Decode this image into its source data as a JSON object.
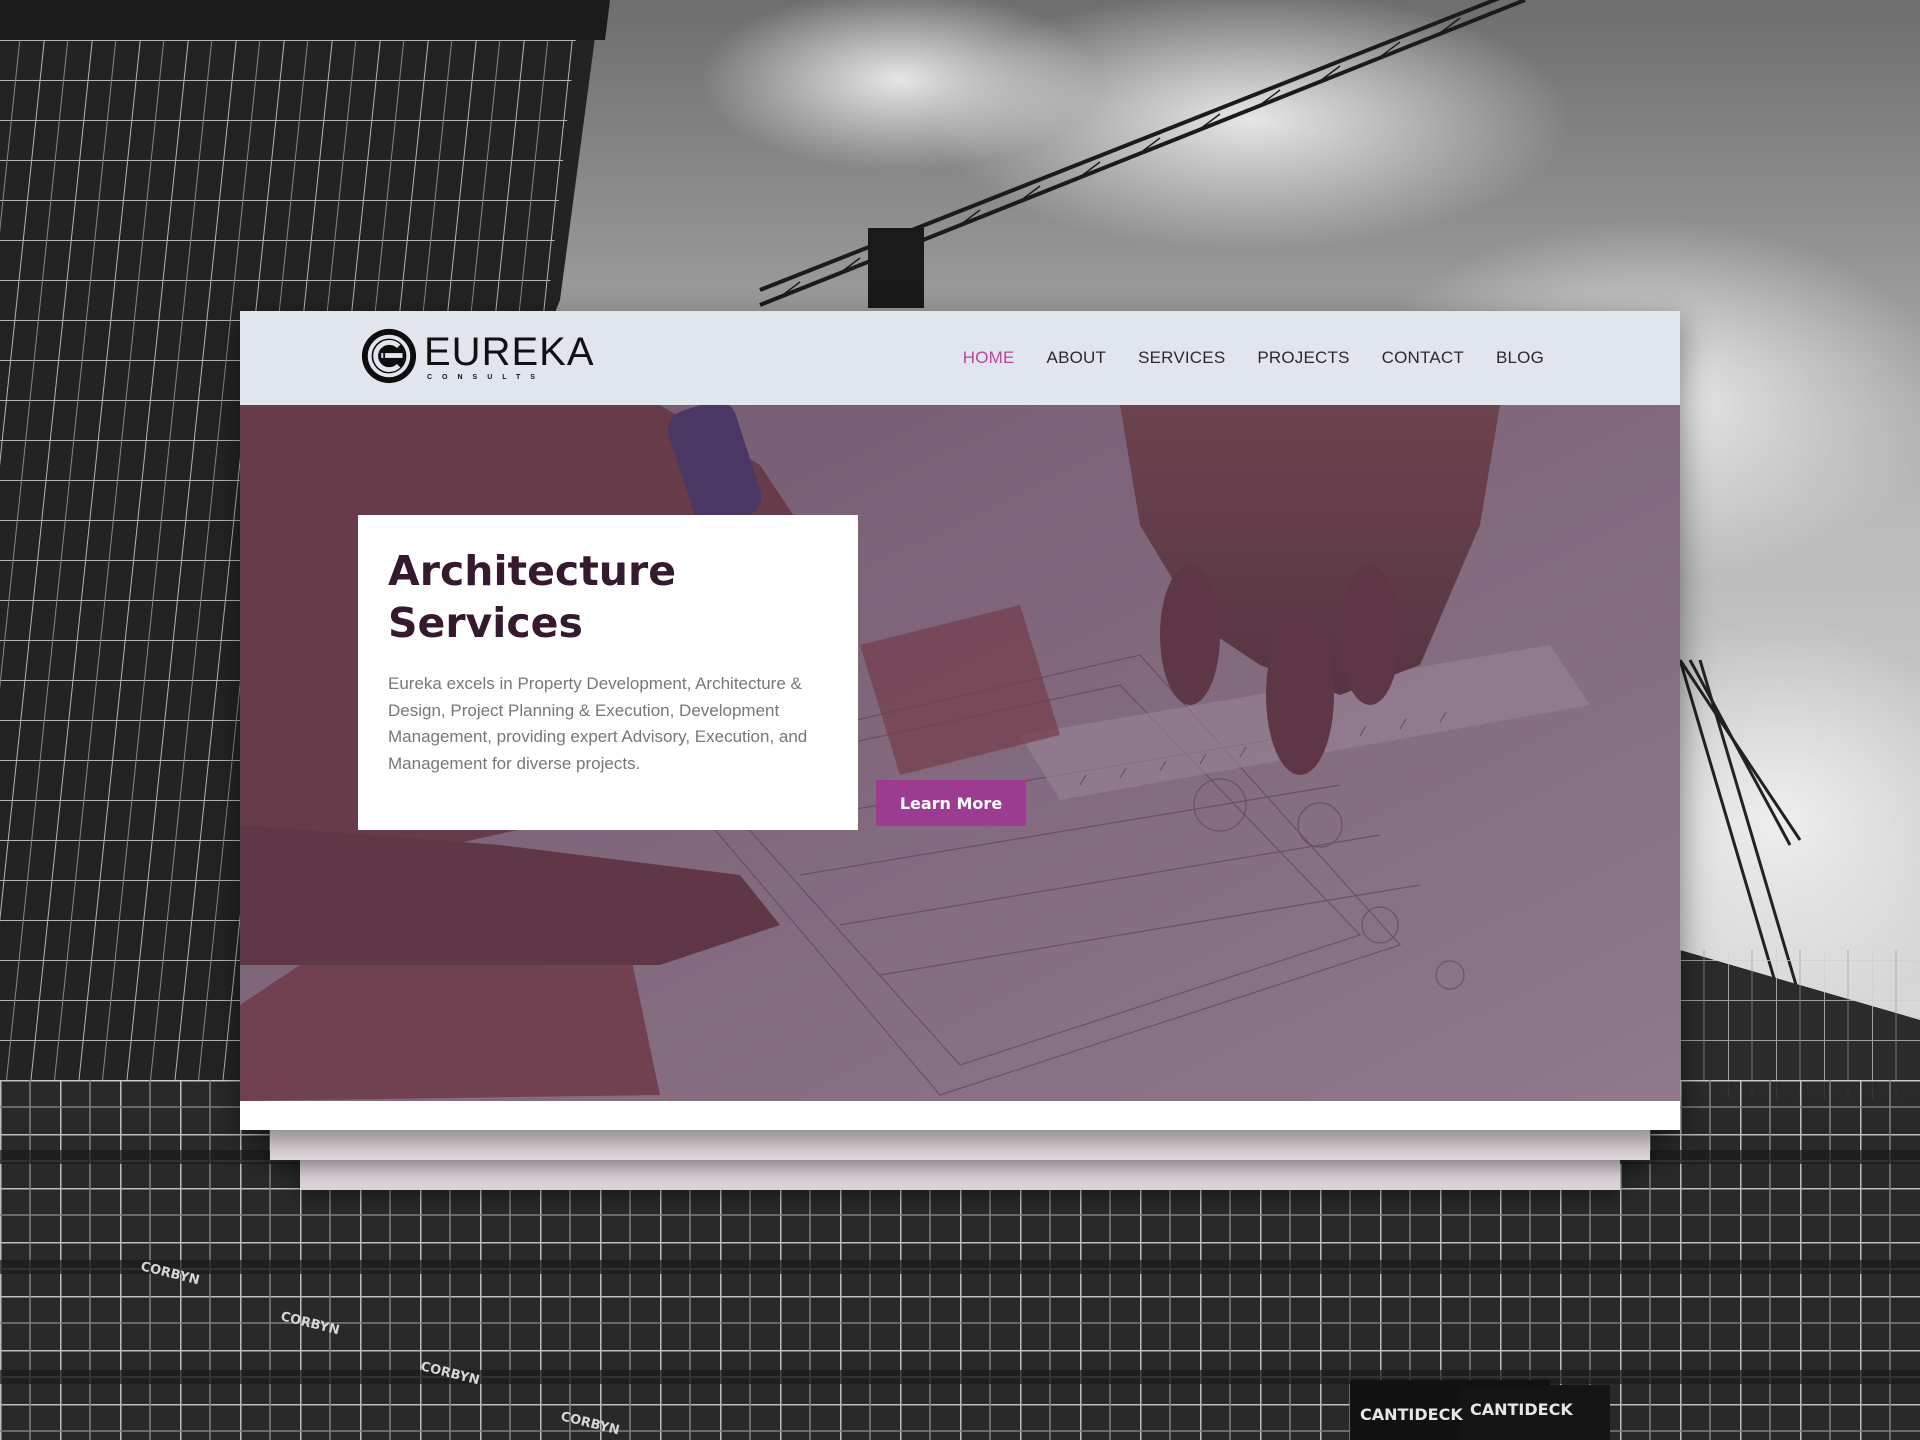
{
  "brand": {
    "name": "EUREKA",
    "tagline": "CONSULTS"
  },
  "nav": {
    "items": [
      {
        "label": "HOME",
        "active": true
      },
      {
        "label": "ABOUT",
        "active": false
      },
      {
        "label": "SERVICES",
        "active": false
      },
      {
        "label": "PROJECTS",
        "active": false
      },
      {
        "label": "CONTACT",
        "active": false
      },
      {
        "label": "BLOG",
        "active": false
      }
    ]
  },
  "hero": {
    "title_line1": "Architecture",
    "title_line2": "Services",
    "description": "Eureka excels in Property Development, Architecture & Design, Project Planning & Execution, Development Management, providing expert Advisory, Execution, and Management for diverse projects.",
    "cta_label": "Learn More"
  },
  "background": {
    "signage": [
      "CORBYN",
      "CANTIDECK"
    ]
  },
  "colors": {
    "accent": "#9b3c91",
    "nav_active": "#b8479f",
    "title": "#35192f",
    "header_bg": "#e1e6ee",
    "hero_tint": "#603e5c"
  },
  "icons": {
    "logo": "eureka-logo-icon"
  }
}
